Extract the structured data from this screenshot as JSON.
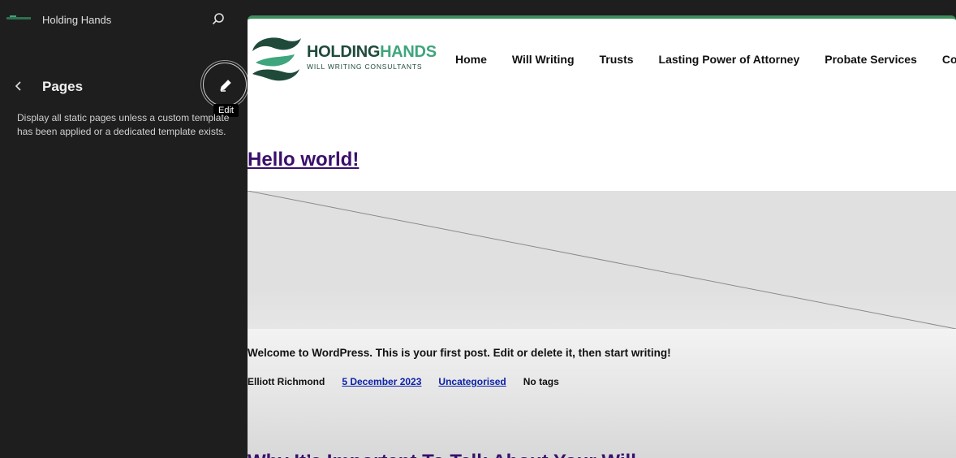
{
  "sidebar": {
    "site_title": "Holding Hands",
    "search_icon": "search-icon",
    "back_icon": "chevron-left-icon",
    "section_title": "Pages",
    "edit_icon": "pencil-icon",
    "edit_tooltip": "Edit",
    "description": "Display all static pages unless a custom template has been applied or a dedicated template exists."
  },
  "preview": {
    "accent_color": "#3e8e5c",
    "logo": {
      "name_part1": "HOLDING",
      "name_part2": "HANDS",
      "tagline": "WILL WRITING CONSULTANTS"
    },
    "nav": [
      "Home",
      "Will Writing",
      "Trusts",
      "Lasting Power of Attorney",
      "Probate Services",
      "Contact"
    ],
    "post": {
      "title": "Hello world!",
      "excerpt": "Welcome to WordPress. This is your first post. Edit or delete it, then start writing!",
      "author": "Elliott Richmond",
      "date": "5 December 2023",
      "category": "Uncategorised",
      "tags": "No tags"
    },
    "next_post_title": "Why It’s Important To Talk About Your Will"
  }
}
